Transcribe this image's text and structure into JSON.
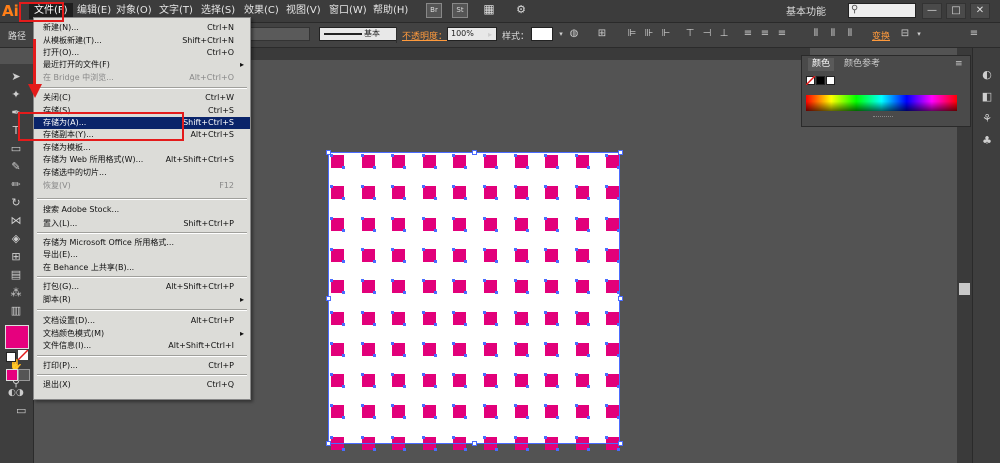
{
  "app": {
    "logo": "Ai"
  },
  "menubar": {
    "items": [
      "文件(F)",
      "编辑(E)",
      "对象(O)",
      "文字(T)",
      "选择(S)",
      "效果(C)",
      "视图(V)",
      "窗口(W)",
      "帮助(H)"
    ],
    "icons": {
      "br": "Br",
      "st": "St"
    },
    "workspace": "基本功能",
    "search_placeholder": "",
    "window_buttons": [
      "—",
      "□",
      "✕"
    ]
  },
  "controlbar": {
    "path_label": "路径",
    "stroke_style": "基本",
    "opacity_label": "不透明度：",
    "opacity_value": "100%",
    "style_label": "样式：",
    "transform_label": "变换"
  },
  "color_panel": {
    "tabs": [
      "颜色",
      "颜色参考"
    ]
  },
  "file_menu": {
    "items": [
      {
        "label": "新建(N)...",
        "shortcut": "Ctrl+N"
      },
      {
        "label": "从模板新建(T)...",
        "shortcut": "Shift+Ctrl+N"
      },
      {
        "label": "打开(O)...",
        "shortcut": "Ctrl+O"
      },
      {
        "label": "最近打开的文件(F)",
        "shortcut": "",
        "submenu": "▸"
      },
      {
        "label": "在 Bridge 中浏览...",
        "shortcut": "Alt+Ctrl+O"
      },
      {
        "label": "关闭(C)",
        "shortcut": "Ctrl+W"
      },
      {
        "label": "存储(S)",
        "shortcut": "Ctrl+S"
      },
      {
        "label": "存储为(A)...",
        "shortcut": "Shift+Ctrl+S"
      },
      {
        "label": "存储副本(Y)...",
        "shortcut": "Alt+Ctrl+S"
      },
      {
        "label": "存储为模板...",
        "shortcut": ""
      },
      {
        "label": "存储为 Web 所用格式(W)...",
        "shortcut": "Alt+Shift+Ctrl+S"
      },
      {
        "label": "存储选中的切片...",
        "shortcut": ""
      },
      {
        "label": "恢复(V)",
        "shortcut": "F12"
      },
      {
        "label": "搜索 Adobe Stock...",
        "shortcut": ""
      },
      {
        "label": "置入(L)...",
        "shortcut": "Shift+Ctrl+P"
      },
      {
        "label": "存储为 Microsoft Office 所用格式...",
        "shortcut": ""
      },
      {
        "label": "导出(E)...",
        "shortcut": ""
      },
      {
        "label": "在 Behance 上共享(B)...",
        "shortcut": ""
      },
      {
        "label": "打包(G)...",
        "shortcut": "Alt+Shift+Ctrl+P"
      },
      {
        "label": "脚本(R)",
        "shortcut": "",
        "submenu": "▸"
      },
      {
        "label": "文档设置(D)...",
        "shortcut": "Alt+Ctrl+P"
      },
      {
        "label": "文档颜色模式(M)",
        "shortcut": "",
        "submenu": "▸"
      },
      {
        "label": "文件信息(I)...",
        "shortcut": "Alt+Shift+Ctrl+I"
      },
      {
        "label": "打印(P)...",
        "shortcut": "Ctrl+P"
      },
      {
        "label": "退出(X)",
        "shortcut": "Ctrl+Q"
      }
    ]
  },
  "colors": {
    "fill": "#e6007e",
    "dot": "#e2007a",
    "selection": "#4a6bff",
    "annotation": "#e41b1b",
    "menu_highlight": "#0a246a"
  },
  "artboard": {
    "grid_rows": 10,
    "grid_cols": 10
  }
}
